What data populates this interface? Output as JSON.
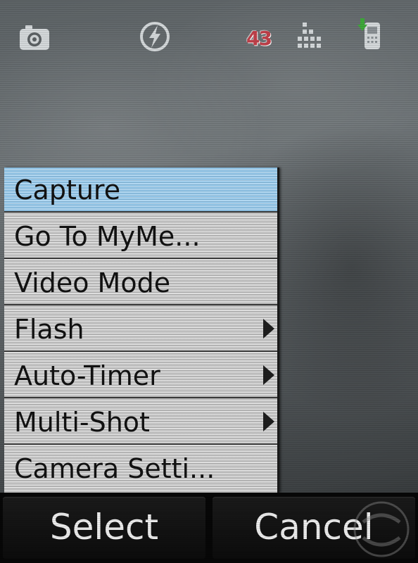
{
  "status_bar": {
    "icons": [
      "camera-icon",
      "flash-icon",
      "signal-bars-icon",
      "phone-download-icon"
    ],
    "battery_value": "43"
  },
  "menu": {
    "selected_index": 0,
    "items": [
      {
        "label": "Capture",
        "has_submenu": false
      },
      {
        "label": "Go To MyMe...",
        "has_submenu": false
      },
      {
        "label": "Video Mode",
        "has_submenu": false
      },
      {
        "label": "Flash",
        "has_submenu": true
      },
      {
        "label": "Auto-Timer",
        "has_submenu": true
      },
      {
        "label": "Multi-Shot",
        "has_submenu": true
      },
      {
        "label": "Camera Setti...",
        "has_submenu": false
      }
    ]
  },
  "softkeys": {
    "left": "Select",
    "right": "Cancel"
  },
  "colors": {
    "selection": "#9fcdee",
    "menu_bg": "#d0d0d0",
    "battery_text": "#c0404a",
    "softkey_text": "#ececec"
  },
  "watermark": {
    "icon": "phonescoop-watermark-icon"
  }
}
